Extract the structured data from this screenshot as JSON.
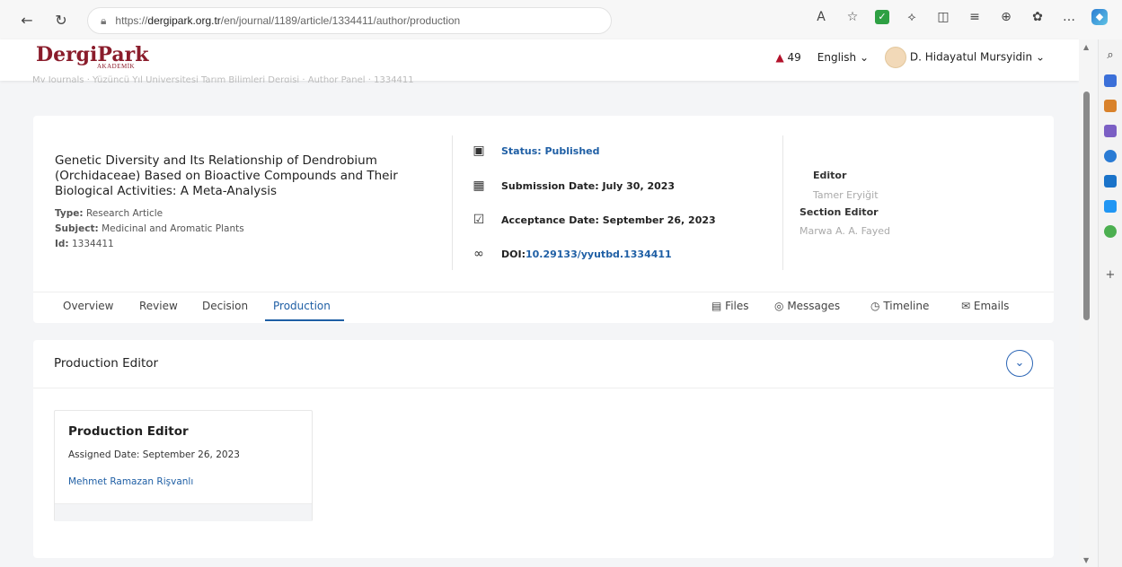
{
  "browser": {
    "url_prefix": "https://",
    "url_domain": "dergipark.org.tr",
    "url_path": "/en/journal/1189/article/1334411/author/production"
  },
  "header": {
    "logo": "DergiPark",
    "logo_sub": "AKADEMİK",
    "notifications": "49",
    "language": "English",
    "user": "D. Hidayatul Mursyidin"
  },
  "breadcrumb": "My Journals  ·  Yüzüncü Yıl Üniversitesi Tarım Bilimleri Dergisi  ·  Author Panel  ·  1334411",
  "article": {
    "title": "Genetic Diversity and Its Relationship of Dendrobium (Orchidaceae) Based on Bioactive Compounds and Their Biological Activities: A Meta-Analysis",
    "type_label": "Type:",
    "type_value": "Research Article",
    "subject_label": "Subject:",
    "subject_value": "Medicinal and Aromatic Plants",
    "id_label": "Id:",
    "id_value": "1334411",
    "status": "Status: Published",
    "submission": "Submission Date: July 30, 2023",
    "acceptance": "Acceptance Date: September 26, 2023",
    "doi_label": "DOI:",
    "doi_value": "10.29133/yyutbd.1334411",
    "editor_label": "Editor",
    "editor_name": "Tamer Eryiğit",
    "section_editor_label": "Section Editor",
    "section_editor_name": "Marwa A. A. Fayed"
  },
  "tabs": [
    "Overview",
    "Review",
    "Decision",
    "Production"
  ],
  "right_tabs": [
    "Files",
    "Messages",
    "Timeline",
    "Emails"
  ],
  "section": {
    "title": "Production Editor",
    "card_title": "Production Editor",
    "assigned": "Assigned Date: September 26, 2023",
    "editor": "Mehmet Ramazan Rişvanlı"
  }
}
